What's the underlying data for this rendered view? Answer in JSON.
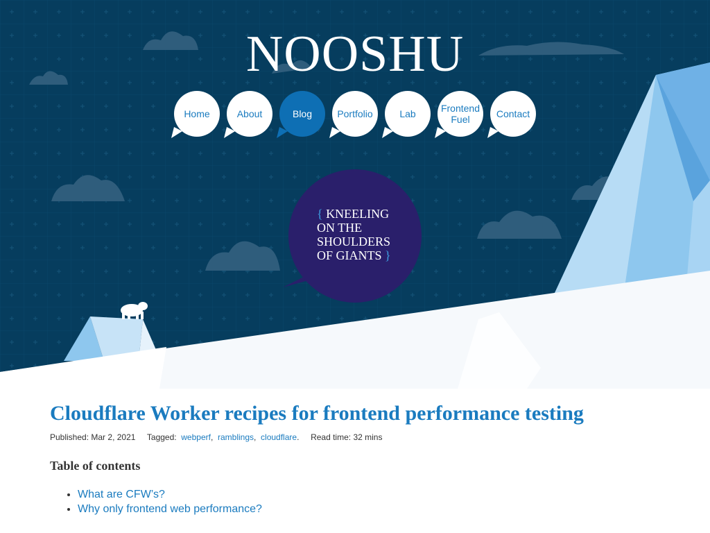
{
  "site": {
    "title": "NOOSHU"
  },
  "nav": {
    "items": [
      {
        "label": "Home",
        "active": false
      },
      {
        "label": "About",
        "active": false
      },
      {
        "label": "Blog",
        "active": true
      },
      {
        "label": "Portfolio",
        "active": false
      },
      {
        "label": "Lab",
        "active": false
      },
      {
        "label": "Frontend Fuel",
        "active": false
      },
      {
        "label": "Contact",
        "active": false
      }
    ]
  },
  "hero": {
    "tagline_line1": "KNEELING",
    "tagline_line2": "ON THE",
    "tagline_line3": "SHOULDERS",
    "tagline_line4": "OF GIANTS",
    "brace_open": "{",
    "brace_close": "}"
  },
  "article": {
    "title": "Cloudflare Worker recipes for frontend performance testing",
    "published_label": "Published:",
    "published_date": "Mar 2, 2021",
    "tagged_label": "Tagged:",
    "tags": [
      "webperf",
      "ramblings",
      "cloudflare"
    ],
    "read_time_label": "Read time:",
    "read_time": "32 mins",
    "toc_heading": "Table of contents",
    "toc": [
      "What are CFW’s?",
      "Why only frontend web performance?"
    ]
  },
  "colors": {
    "sky": "#063d5e",
    "accent": "#1a7bbf",
    "nav_active": "#0e6fb4",
    "tagline_bubble": "#2a1f6b",
    "ice_light": "#9fd0f0"
  },
  "icons": {
    "mascot": "polar-bear-icon"
  }
}
